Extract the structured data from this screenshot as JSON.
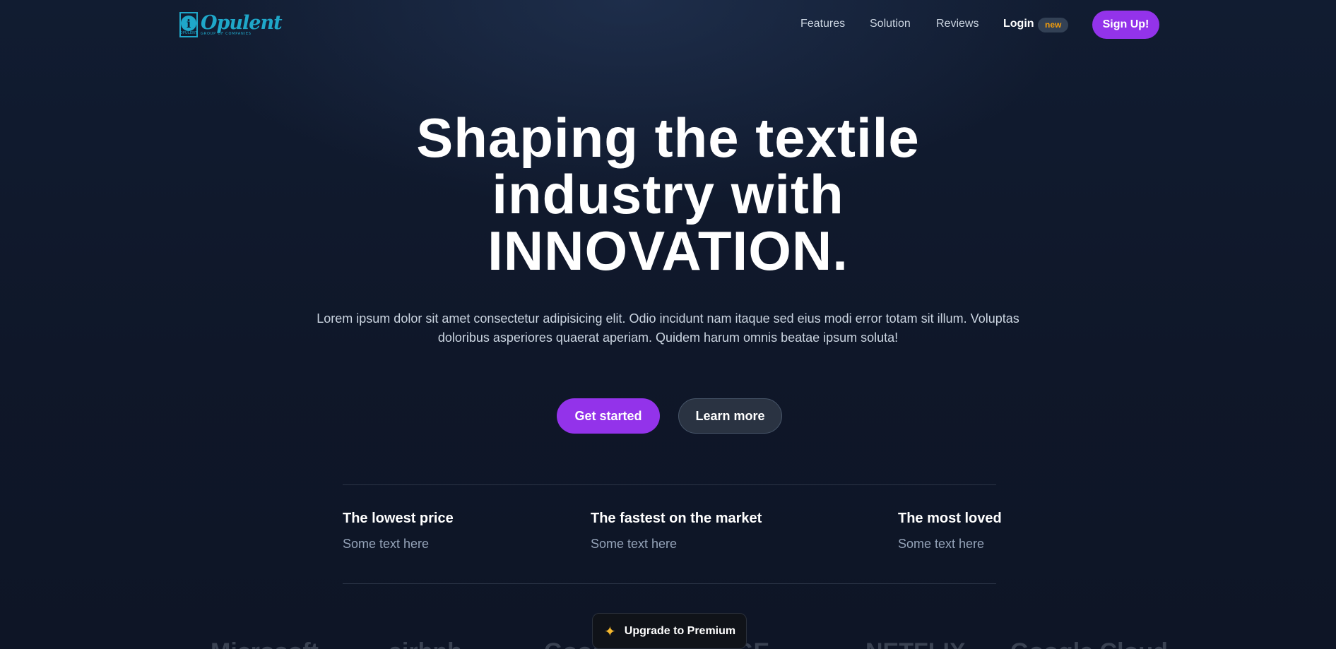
{
  "nav": {
    "logo_word": "Opulent",
    "logo_tagline": "GROUP OF COMPANIES",
    "logo_mark_sub": "OPULENT",
    "logo_mark_letter": "i",
    "links": [
      {
        "label": "Features"
      },
      {
        "label": "Solution"
      },
      {
        "label": "Reviews"
      }
    ],
    "login_label": "Login",
    "login_badge": "new",
    "signup_label": "Sign Up!"
  },
  "hero": {
    "title_line1": "Shaping the textile",
    "title_line2": "industry with",
    "title_line3": "INNOVATION.",
    "description": "Lorem ipsum dolor sit amet consectetur adipisicing elit. Odio incidunt nam itaque sed eius modi error totam sit illum. Voluptas doloribus asperiores quaerat aperiam. Quidem harum omnis beatae ipsum soluta!",
    "primary_cta": "Get started",
    "secondary_cta": "Learn more"
  },
  "features": [
    {
      "title": "The lowest price",
      "text": "Some text here"
    },
    {
      "title": "The fastest on the market",
      "text": "Some text here"
    },
    {
      "title": "The most loved",
      "text": "Some text here"
    }
  ],
  "brands": [
    "Microsoft",
    "airbnb",
    "Google",
    "GE",
    "NETFLIX",
    "Google Cloud"
  ],
  "upgrade": {
    "icon": "sparkle-icon",
    "label": "Upgrade to Premium"
  },
  "colors": {
    "accent": "#9333ea",
    "logo": "#1fa7c9",
    "badge_text": "#f59e0b",
    "background": "#0f172a"
  }
}
